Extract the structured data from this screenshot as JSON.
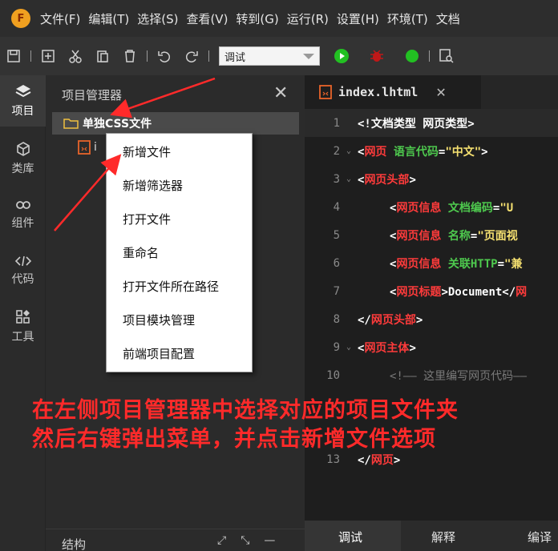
{
  "app": {
    "logo_letter": "F",
    "menus": [
      "文件(F)",
      "编辑(T)",
      "选择(S)",
      "查看(V)",
      "转到(G)",
      "运行(R)",
      "设置(H)",
      "环境(T)",
      "文档"
    ]
  },
  "toolbar": {
    "mode_select": "调试",
    "icons": [
      "save-icon",
      "new-file-icon",
      "cut-icon",
      "paste-icon",
      "delete-icon",
      "undo-icon",
      "redo-icon",
      "run-icon",
      "debug-icon",
      "status-icon",
      "find-icon"
    ]
  },
  "activity": {
    "items": [
      {
        "label": "项目",
        "icon": "layers-icon"
      },
      {
        "label": "类库",
        "icon": "cube-icon"
      },
      {
        "label": "组件",
        "icon": "link-icon"
      },
      {
        "label": "代码",
        "icon": "code-icon"
      },
      {
        "label": "工具",
        "icon": "tools-icon"
      }
    ]
  },
  "project": {
    "title": "项目管理器",
    "close": "✕",
    "folder": "单独CSS文件",
    "file_partial": "i",
    "structure_title": "结构"
  },
  "context_menu": {
    "items": [
      "新增文件",
      "新增筛选器",
      "打开文件",
      "重命名",
      "打开文件所在路径",
      "项目模块管理",
      "前端项目配置"
    ]
  },
  "editor": {
    "tab": "index.lhtml",
    "tab_close": "✕",
    "lines": [
      {
        "n": "1",
        "fold": "",
        "parts": [
          {
            "t": "<!文档类型 网页类型>",
            "c": "w"
          }
        ]
      },
      {
        "n": "2",
        "fold": "⌄",
        "parts": [
          {
            "t": "<",
            "c": "w"
          },
          {
            "t": "网页",
            "c": "k"
          },
          {
            "t": " 语言代码",
            "c": "a"
          },
          {
            "t": "=",
            "c": "w"
          },
          {
            "t": "\"中文\"",
            "c": "s"
          },
          {
            "t": ">",
            "c": "w"
          }
        ]
      },
      {
        "n": "3",
        "fold": "⌄",
        "parts": [
          {
            "t": "<",
            "c": "w"
          },
          {
            "t": "网页头部",
            "c": "k"
          },
          {
            "t": ">",
            "c": "w"
          }
        ]
      },
      {
        "n": "4",
        "fold": "",
        "indent": true,
        "parts": [
          {
            "t": "<",
            "c": "w"
          },
          {
            "t": "网页信息",
            "c": "k"
          },
          {
            "t": " 文档编码",
            "c": "a"
          },
          {
            "t": "=",
            "c": "w"
          },
          {
            "t": "\"U",
            "c": "s"
          }
        ]
      },
      {
        "n": "5",
        "fold": "",
        "indent": true,
        "parts": [
          {
            "t": "<",
            "c": "w"
          },
          {
            "t": "网页信息",
            "c": "k"
          },
          {
            "t": " 名称",
            "c": "a"
          },
          {
            "t": "=",
            "c": "w"
          },
          {
            "t": "\"页面视",
            "c": "s"
          }
        ]
      },
      {
        "n": "6",
        "fold": "",
        "indent": true,
        "parts": [
          {
            "t": "<",
            "c": "w"
          },
          {
            "t": "网页信息",
            "c": "k"
          },
          {
            "t": " 关联HTTP",
            "c": "a"
          },
          {
            "t": "=",
            "c": "w"
          },
          {
            "t": "\"兼",
            "c": "s"
          }
        ]
      },
      {
        "n": "7",
        "fold": "",
        "indent": true,
        "parts": [
          {
            "t": "<",
            "c": "w"
          },
          {
            "t": "网页标题",
            "c": "k"
          },
          {
            "t": ">Document</",
            "c": "w"
          },
          {
            "t": "网",
            "c": "k"
          }
        ]
      },
      {
        "n": "8",
        "fold": "",
        "parts": [
          {
            "t": "</",
            "c": "w"
          },
          {
            "t": "网页头部",
            "c": "k"
          },
          {
            "t": ">",
            "c": "w"
          }
        ]
      },
      {
        "n": "9",
        "fold": "⌄",
        "parts": [
          {
            "t": "<",
            "c": "w"
          },
          {
            "t": "网页主体",
            "c": "k"
          },
          {
            "t": ">",
            "c": "w"
          }
        ]
      },
      {
        "n": "10",
        "fold": "",
        "indent": true,
        "parts": [
          {
            "t": "<!—— 这里编写网页代码——",
            "c": "c"
          }
        ]
      },
      {
        "n": "13",
        "fold": "",
        "parts": [
          {
            "t": "</",
            "c": "w"
          },
          {
            "t": "网页",
            "c": "k"
          },
          {
            "t": ">",
            "c": "w"
          }
        ]
      }
    ],
    "bottom_tabs": [
      "调试",
      "解释",
      "编译"
    ]
  },
  "annotation": {
    "line1": "在左侧项目管理器中选择对应的项目文件夹",
    "line2": "然后右键弹出菜单，并点击新增文件选项"
  },
  "colors": {
    "keyword": "#ff3b3b",
    "attribute": "#4ec94e",
    "string": "#f5e070",
    "annotation": "#ff2a2a",
    "logo": "#f0a020"
  }
}
